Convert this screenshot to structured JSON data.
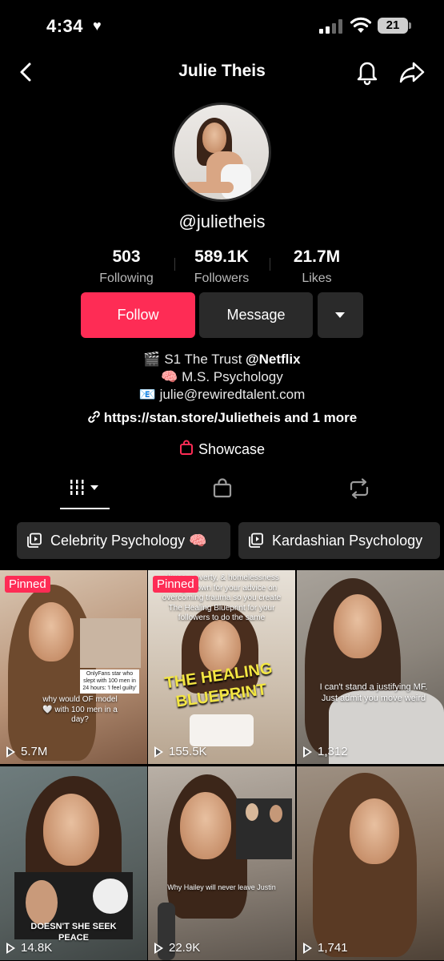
{
  "status_bar": {
    "time": "4:34",
    "battery": "21"
  },
  "header": {
    "title": "Julie Theis"
  },
  "profile": {
    "username": "@julietheis",
    "stats": [
      {
        "value": "503",
        "label": "Following"
      },
      {
        "value": "589.1K",
        "label": "Followers"
      },
      {
        "value": "21.7M",
        "label": "Likes"
      }
    ]
  },
  "actions": {
    "follow": "Follow",
    "message": "Message"
  },
  "bio": {
    "line1_emoji": "🎬",
    "line1_text": "S1 The Trust ",
    "line1_bold": "@Netflix",
    "line2_emoji": "🧠",
    "line2_text": "M.S. Psychology",
    "line3_emoji": "📧",
    "line3_text": "julie@rewiredtalent.com",
    "link": "https://stan.store/Julietheis",
    "link_more": "and 1 more",
    "showcase": "Showcase"
  },
  "playlists": [
    {
      "label": "Celebrity Psychology 🧠"
    },
    {
      "label": "Kardashian Psychology"
    }
  ],
  "videos": [
    {
      "pinned": "Pinned",
      "views": "5.7M",
      "caption_top": "OnlyFans star who slept with 100 men in 24 hours: 'I feel guilty'",
      "caption": "why would OF model 🤍 with 100 men in a day?"
    },
    {
      "pinned": "Pinned",
      "views": "155.5K",
      "caption_top": "abuse, poverty, & homelessness being known for your advice on overcoming trauma so you create The Healing Blueprint for your followers to do the same",
      "caption": "THE HEALING BLUEPRINT"
    },
    {
      "pinned": "",
      "views": "1,312",
      "caption": "I can't stand a justifying MF. Just admit you move weird"
    },
    {
      "pinned": "",
      "views": "14.8K",
      "caption": "DOESN'T SHE SEEK PEACE"
    },
    {
      "pinned": "",
      "views": "22.9K",
      "caption": "Why Hailey will never leave Justin"
    },
    {
      "pinned": "",
      "views": "1,741",
      "caption": ""
    }
  ]
}
